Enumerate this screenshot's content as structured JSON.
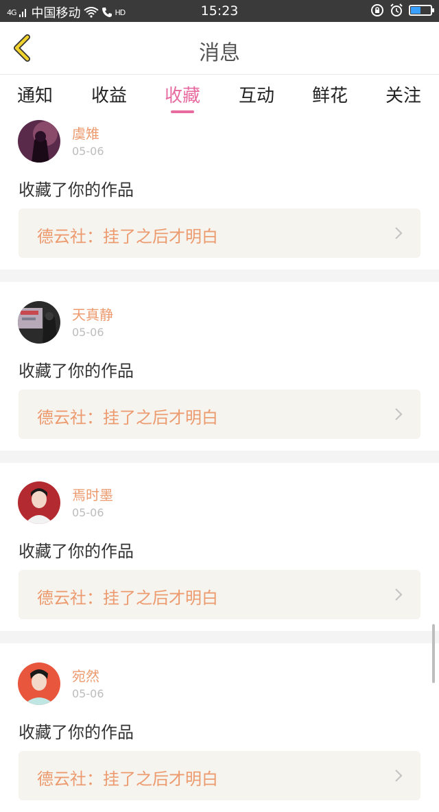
{
  "status_bar": {
    "network": "4G",
    "carrier": "中国移动",
    "call_badge": "HD",
    "time": "15:23"
  },
  "header": {
    "title": "消息"
  },
  "tabs": [
    {
      "label": "通知",
      "active": false
    },
    {
      "label": "收益",
      "active": false
    },
    {
      "label": "收藏",
      "active": true
    },
    {
      "label": "互动",
      "active": false
    },
    {
      "label": "鲜花",
      "active": false
    },
    {
      "label": "关注",
      "active": false
    }
  ],
  "feed": [
    {
      "user": "虞雉",
      "date": "05-06",
      "action": "收藏了你的作品",
      "work": "德云社：挂了之后才明白"
    },
    {
      "user": "天真静",
      "date": "05-06",
      "action": "收藏了你的作品",
      "work": "德云社：挂了之后才明白"
    },
    {
      "user": "焉时墨",
      "date": "05-06",
      "action": "收藏了你的作品",
      "work": "德云社：挂了之后才明白"
    },
    {
      "user": "宛然",
      "date": "05-06",
      "action": "收藏了你的作品",
      "work": "德云社：挂了之后才明白"
    }
  ],
  "colors": {
    "accent": "#e86ba0",
    "username": "#ec9a6e",
    "status_bar": "#3a3a3a",
    "back_arrow": "#f2d32e"
  }
}
